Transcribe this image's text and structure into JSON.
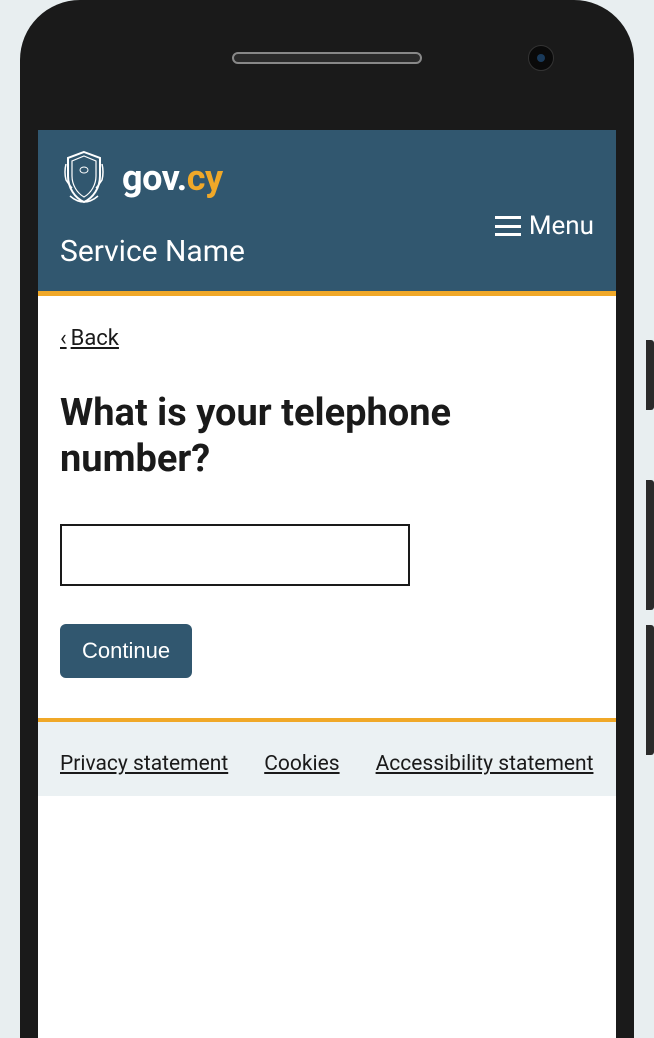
{
  "header": {
    "logo": {
      "gov": "gov.",
      "cy": "cy"
    },
    "menu_label": "Menu",
    "service_name": "Service Name"
  },
  "main": {
    "back_label": "Back",
    "heading": "What is your telephone number?",
    "input_value": "",
    "continue_label": "Continue"
  },
  "footer": {
    "links": [
      "Privacy statement",
      "Cookies",
      "Accessibility statement"
    ]
  },
  "colors": {
    "header_bg": "#31576f",
    "accent": "#f0a828",
    "footer_bg": "#ebf1f3"
  }
}
